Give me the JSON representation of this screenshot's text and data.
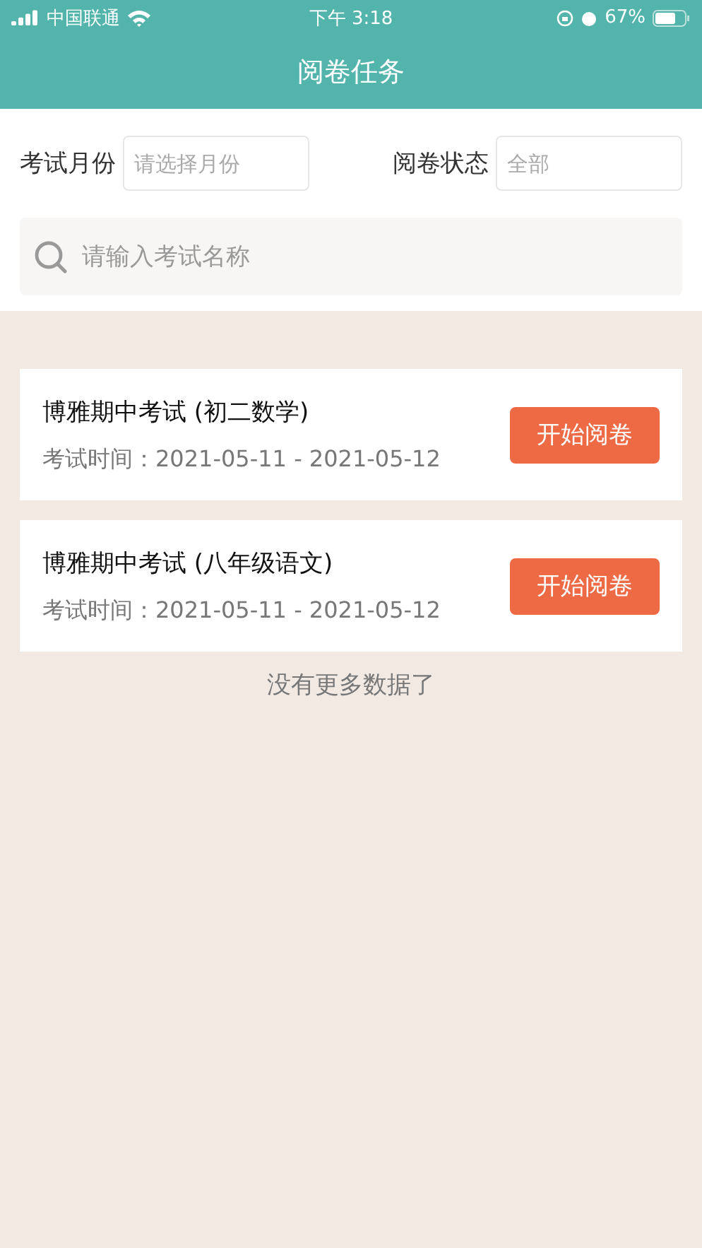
{
  "status_bar": {
    "carrier": "中国联通",
    "time": "下午 3:18",
    "battery": "67%"
  },
  "nav": {
    "title": "阅卷任务"
  },
  "filters": [
    {
      "label": "考试月份",
      "placeholder": "请选择月份"
    },
    {
      "label": "阅卷状态",
      "placeholder": "全部"
    }
  ],
  "search": {
    "placeholder": "请输入考试名称"
  },
  "exams": [
    {
      "title": "博雅期中考试 (初二数学)",
      "time": "考试时间：2021-05-11 - 2021-05-12",
      "button": "开始阅卷"
    },
    {
      "title": "博雅期中考试 (八年级语文)",
      "time": "考试时间：2021-05-11 - 2021-05-12",
      "button": "开始阅卷"
    }
  ],
  "footer": "没有更多数据了"
}
